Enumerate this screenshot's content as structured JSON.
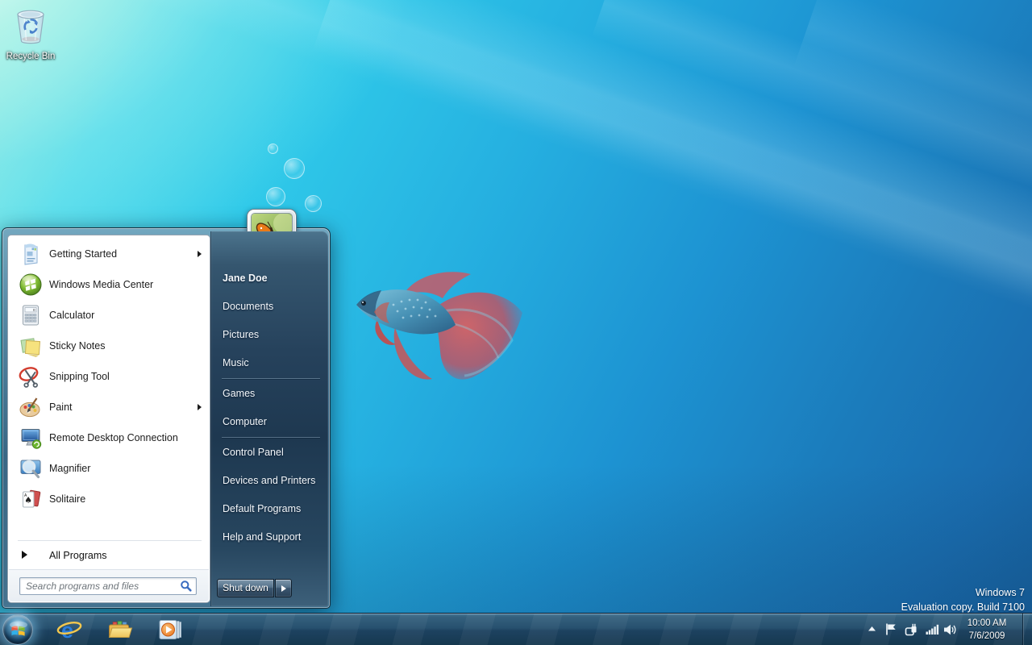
{
  "desktop": {
    "recycle_bin_label": "Recycle Bin",
    "watermark_line1": "Windows 7",
    "watermark_line2": "Evaluation copy. Build 7100"
  },
  "start_menu": {
    "left_items": [
      {
        "label": "Getting Started",
        "icon": "getting-started-icon",
        "has_submenu": true
      },
      {
        "label": "Windows Media Center",
        "icon": "windows-media-center-icon",
        "has_submenu": false
      },
      {
        "label": "Calculator",
        "icon": "calculator-icon",
        "has_submenu": false
      },
      {
        "label": "Sticky Notes",
        "icon": "sticky-notes-icon",
        "has_submenu": false
      },
      {
        "label": "Snipping Tool",
        "icon": "snipping-tool-icon",
        "has_submenu": false
      },
      {
        "label": "Paint",
        "icon": "paint-icon",
        "has_submenu": true
      },
      {
        "label": "Remote Desktop Connection",
        "icon": "remote-desktop-icon",
        "has_submenu": false
      },
      {
        "label": "Magnifier",
        "icon": "magnifier-icon",
        "has_submenu": false
      },
      {
        "label": "Solitaire",
        "icon": "solitaire-icon",
        "has_submenu": false
      }
    ],
    "all_programs_label": "All Programs",
    "search_placeholder": "Search programs and files",
    "user_name": "Jane Doe",
    "right_items": [
      "Documents",
      "Pictures",
      "Music",
      "Games",
      "Computer",
      "Control Panel",
      "Devices and Printers",
      "Default Programs",
      "Help and Support"
    ],
    "shutdown_label": "Shut down"
  },
  "taskbar": {
    "buttons": [
      "start",
      "internet-explorer",
      "windows-explorer",
      "windows-media-player"
    ],
    "tray_icons": [
      "show-hidden-icons",
      "action-center-flag",
      "power-plug",
      "network-signal",
      "volume"
    ],
    "clock_time": "10:00 AM",
    "clock_date": "7/6/2009"
  },
  "colors": {
    "desktop_top_left": "#c9f5ec",
    "desktop_cyan": "#2bc7e9",
    "desktop_bottom_right": "#17619e",
    "taskbar": "#27506e",
    "menu_glass_dark": "#1f3348"
  }
}
